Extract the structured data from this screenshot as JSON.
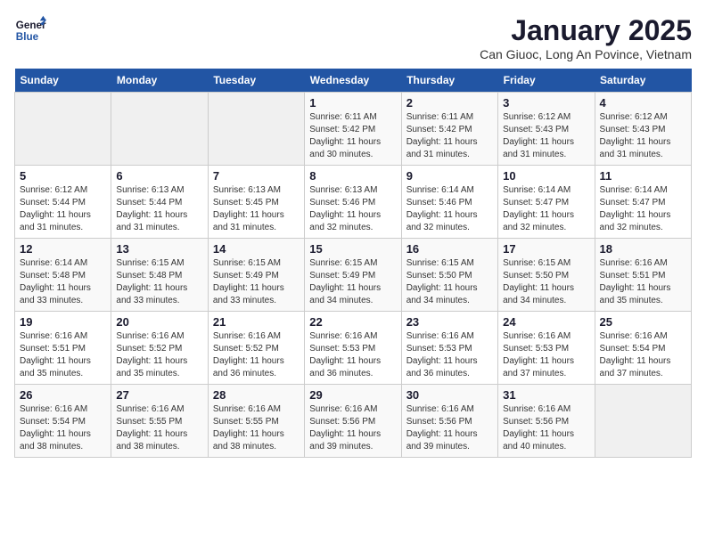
{
  "header": {
    "logo_line1": "General",
    "logo_line2": "Blue",
    "main_title": "January 2025",
    "subtitle": "Can Giuoc, Long An Povince, Vietnam"
  },
  "days_of_week": [
    "Sunday",
    "Monday",
    "Tuesday",
    "Wednesday",
    "Thursday",
    "Friday",
    "Saturday"
  ],
  "weeks": [
    [
      {
        "day": "",
        "info": ""
      },
      {
        "day": "",
        "info": ""
      },
      {
        "day": "",
        "info": ""
      },
      {
        "day": "1",
        "info": "Sunrise: 6:11 AM\nSunset: 5:42 PM\nDaylight: 11 hours\nand 30 minutes."
      },
      {
        "day": "2",
        "info": "Sunrise: 6:11 AM\nSunset: 5:42 PM\nDaylight: 11 hours\nand 31 minutes."
      },
      {
        "day": "3",
        "info": "Sunrise: 6:12 AM\nSunset: 5:43 PM\nDaylight: 11 hours\nand 31 minutes."
      },
      {
        "day": "4",
        "info": "Sunrise: 6:12 AM\nSunset: 5:43 PM\nDaylight: 11 hours\nand 31 minutes."
      }
    ],
    [
      {
        "day": "5",
        "info": "Sunrise: 6:12 AM\nSunset: 5:44 PM\nDaylight: 11 hours\nand 31 minutes."
      },
      {
        "day": "6",
        "info": "Sunrise: 6:13 AM\nSunset: 5:44 PM\nDaylight: 11 hours\nand 31 minutes."
      },
      {
        "day": "7",
        "info": "Sunrise: 6:13 AM\nSunset: 5:45 PM\nDaylight: 11 hours\nand 31 minutes."
      },
      {
        "day": "8",
        "info": "Sunrise: 6:13 AM\nSunset: 5:46 PM\nDaylight: 11 hours\nand 32 minutes."
      },
      {
        "day": "9",
        "info": "Sunrise: 6:14 AM\nSunset: 5:46 PM\nDaylight: 11 hours\nand 32 minutes."
      },
      {
        "day": "10",
        "info": "Sunrise: 6:14 AM\nSunset: 5:47 PM\nDaylight: 11 hours\nand 32 minutes."
      },
      {
        "day": "11",
        "info": "Sunrise: 6:14 AM\nSunset: 5:47 PM\nDaylight: 11 hours\nand 32 minutes."
      }
    ],
    [
      {
        "day": "12",
        "info": "Sunrise: 6:14 AM\nSunset: 5:48 PM\nDaylight: 11 hours\nand 33 minutes."
      },
      {
        "day": "13",
        "info": "Sunrise: 6:15 AM\nSunset: 5:48 PM\nDaylight: 11 hours\nand 33 minutes."
      },
      {
        "day": "14",
        "info": "Sunrise: 6:15 AM\nSunset: 5:49 PM\nDaylight: 11 hours\nand 33 minutes."
      },
      {
        "day": "15",
        "info": "Sunrise: 6:15 AM\nSunset: 5:49 PM\nDaylight: 11 hours\nand 34 minutes."
      },
      {
        "day": "16",
        "info": "Sunrise: 6:15 AM\nSunset: 5:50 PM\nDaylight: 11 hours\nand 34 minutes."
      },
      {
        "day": "17",
        "info": "Sunrise: 6:15 AM\nSunset: 5:50 PM\nDaylight: 11 hours\nand 34 minutes."
      },
      {
        "day": "18",
        "info": "Sunrise: 6:16 AM\nSunset: 5:51 PM\nDaylight: 11 hours\nand 35 minutes."
      }
    ],
    [
      {
        "day": "19",
        "info": "Sunrise: 6:16 AM\nSunset: 5:51 PM\nDaylight: 11 hours\nand 35 minutes."
      },
      {
        "day": "20",
        "info": "Sunrise: 6:16 AM\nSunset: 5:52 PM\nDaylight: 11 hours\nand 35 minutes."
      },
      {
        "day": "21",
        "info": "Sunrise: 6:16 AM\nSunset: 5:52 PM\nDaylight: 11 hours\nand 36 minutes."
      },
      {
        "day": "22",
        "info": "Sunrise: 6:16 AM\nSunset: 5:53 PM\nDaylight: 11 hours\nand 36 minutes."
      },
      {
        "day": "23",
        "info": "Sunrise: 6:16 AM\nSunset: 5:53 PM\nDaylight: 11 hours\nand 36 minutes."
      },
      {
        "day": "24",
        "info": "Sunrise: 6:16 AM\nSunset: 5:53 PM\nDaylight: 11 hours\nand 37 minutes."
      },
      {
        "day": "25",
        "info": "Sunrise: 6:16 AM\nSunset: 5:54 PM\nDaylight: 11 hours\nand 37 minutes."
      }
    ],
    [
      {
        "day": "26",
        "info": "Sunrise: 6:16 AM\nSunset: 5:54 PM\nDaylight: 11 hours\nand 38 minutes."
      },
      {
        "day": "27",
        "info": "Sunrise: 6:16 AM\nSunset: 5:55 PM\nDaylight: 11 hours\nand 38 minutes."
      },
      {
        "day": "28",
        "info": "Sunrise: 6:16 AM\nSunset: 5:55 PM\nDaylight: 11 hours\nand 38 minutes."
      },
      {
        "day": "29",
        "info": "Sunrise: 6:16 AM\nSunset: 5:56 PM\nDaylight: 11 hours\nand 39 minutes."
      },
      {
        "day": "30",
        "info": "Sunrise: 6:16 AM\nSunset: 5:56 PM\nDaylight: 11 hours\nand 39 minutes."
      },
      {
        "day": "31",
        "info": "Sunrise: 6:16 AM\nSunset: 5:56 PM\nDaylight: 11 hours\nand 40 minutes."
      },
      {
        "day": "",
        "info": ""
      }
    ]
  ]
}
